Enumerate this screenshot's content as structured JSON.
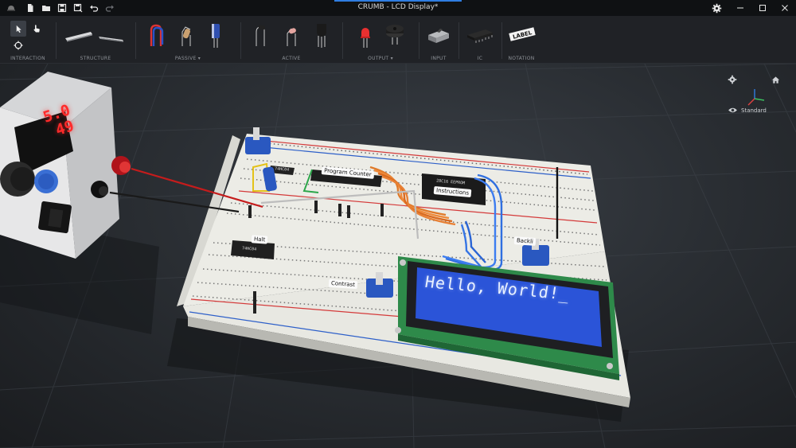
{
  "window": {
    "title": "CRUMB - LCD Display*"
  },
  "toolbar": {
    "groups": [
      {
        "label": "INTERACTION"
      },
      {
        "label": "STRUCTURE"
      },
      {
        "label": "PASSIVE ▾"
      },
      {
        "label": "ACTIVE"
      },
      {
        "label": "OUTPUT ▾"
      },
      {
        "label": "INPUT"
      },
      {
        "label": "IC"
      },
      {
        "label": "NOTATION"
      }
    ],
    "notation_tag": "LABEL"
  },
  "viewport": {
    "view_mode": "Standard"
  },
  "scene": {
    "psu_voltage": "5.0",
    "psu_current": "49",
    "labels": {
      "program_counter": "Program Counter",
      "instructions": "Instructions",
      "halt": "Halt",
      "contrast": "Contrast",
      "backlight": "Backli"
    },
    "lcd_text": "Hello, World!_",
    "chips": {
      "top_left": "74HC04",
      "instructions_chip": "28C16 EEPROM",
      "halt_chip": "74HC04"
    }
  },
  "colors": {
    "accent": "#2f7de1",
    "lcd_background": "#2b54d8",
    "breadboard": "#eeeeea"
  }
}
